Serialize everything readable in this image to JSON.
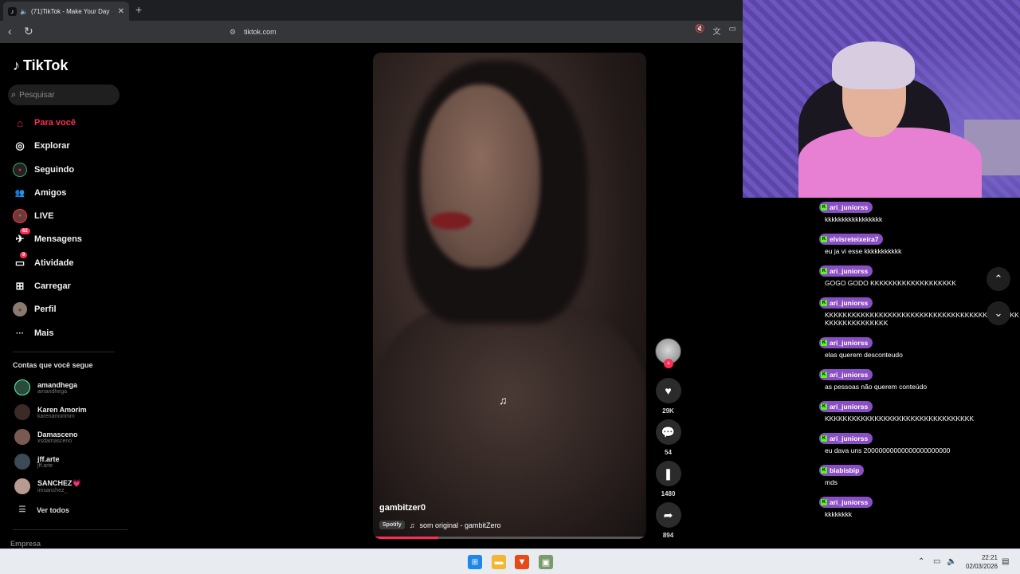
{
  "browser": {
    "tab_title": "(71)TikTok - Make Your Day",
    "url": "tiktok.com",
    "newtab_glyph": "+",
    "close_glyph": "✕"
  },
  "sidebar": {
    "logo": "TikTok",
    "search_placeholder": "Pesquisar",
    "items": [
      {
        "label": "Para você",
        "icon": "home-icon",
        "glyph": "⌂"
      },
      {
        "label": "Explorar",
        "icon": "compass-icon",
        "glyph": "◎"
      },
      {
        "label": "Seguindo",
        "icon": "following-icon",
        "glyph": "●"
      },
      {
        "label": "Amigos",
        "icon": "friends-icon",
        "glyph": "👥"
      },
      {
        "label": "LIVE",
        "icon": "live-icon",
        "glyph": "●"
      },
      {
        "label": "Mensagens",
        "icon": "messages-icon",
        "glyph": "✈",
        "badge": "62"
      },
      {
        "label": "Atividade",
        "icon": "activity-icon",
        "glyph": "▭",
        "badge": "9"
      },
      {
        "label": "Carregar",
        "icon": "upload-icon",
        "glyph": "⊞"
      },
      {
        "label": "Perfil",
        "icon": "profile-icon",
        "glyph": "●"
      },
      {
        "label": "Mais",
        "icon": "more-icon",
        "glyph": "···"
      }
    ],
    "following_title": "Contas que você segue",
    "following": [
      {
        "name": "amandhega",
        "handle": "amandhega"
      },
      {
        "name": "Karen Amorim",
        "handle": "karenamorimm"
      },
      {
        "name": "Damasceno",
        "handle": "xsdamasceno"
      },
      {
        "name": "jff.arte",
        "handle": "jff.arte"
      },
      {
        "name": "SANCHEZ💗",
        "handle": "imsanchez_"
      }
    ],
    "see_all": "Ver todos",
    "footer": "Empresa"
  },
  "video": {
    "author": "gambitzer0",
    "spotify_tag": "Spotify",
    "music": "som original - gambitZero",
    "music_glyph": "♫",
    "progress": 0.24
  },
  "actions": {
    "likes": "29K",
    "comments": "54",
    "saves": "1480",
    "shares": "894"
  },
  "chat": [
    {
      "user": "ari_juniorss",
      "text": "kkkkkkkkkkkkkkkkk"
    },
    {
      "user": "elvisreteixeira7",
      "text": "eu ja vi esse kkkkkkkkkkk"
    },
    {
      "user": "ari_juniorss",
      "text": "GOGO GODO KKKKKKKKKKKKKKKKKKK"
    },
    {
      "user": "ari_juniorss",
      "text": "KKKKKKKKKKKKKKKKKKKKKKKKKKKKKKKKKKKKKKKKKKKKKKKKKKKKKKKKK"
    },
    {
      "user": "ari_juniorss",
      "text": "elas querem desconteudo"
    },
    {
      "user": "ari_juniorss",
      "text": "as pessoas não querem conteúdo"
    },
    {
      "user": "ari_juniorss",
      "text": "KKKKKKKKKKKKKKKKKKKKKKKKKKKKKKKKK"
    },
    {
      "user": "ari_juniorss",
      "text": "eu dava uns 20000000000000000000000"
    },
    {
      "user": "biabisbip",
      "text": "mds"
    },
    {
      "user": "ari_juniorss",
      "text": "kkkkkkkk"
    }
  ],
  "taskbar": {
    "time": "22:21",
    "date": "02/03/2026"
  },
  "colors": {
    "accent": "#fe2c55",
    "chat_user_bg": "#8a4fc4",
    "kick_green": "#53fc18"
  }
}
